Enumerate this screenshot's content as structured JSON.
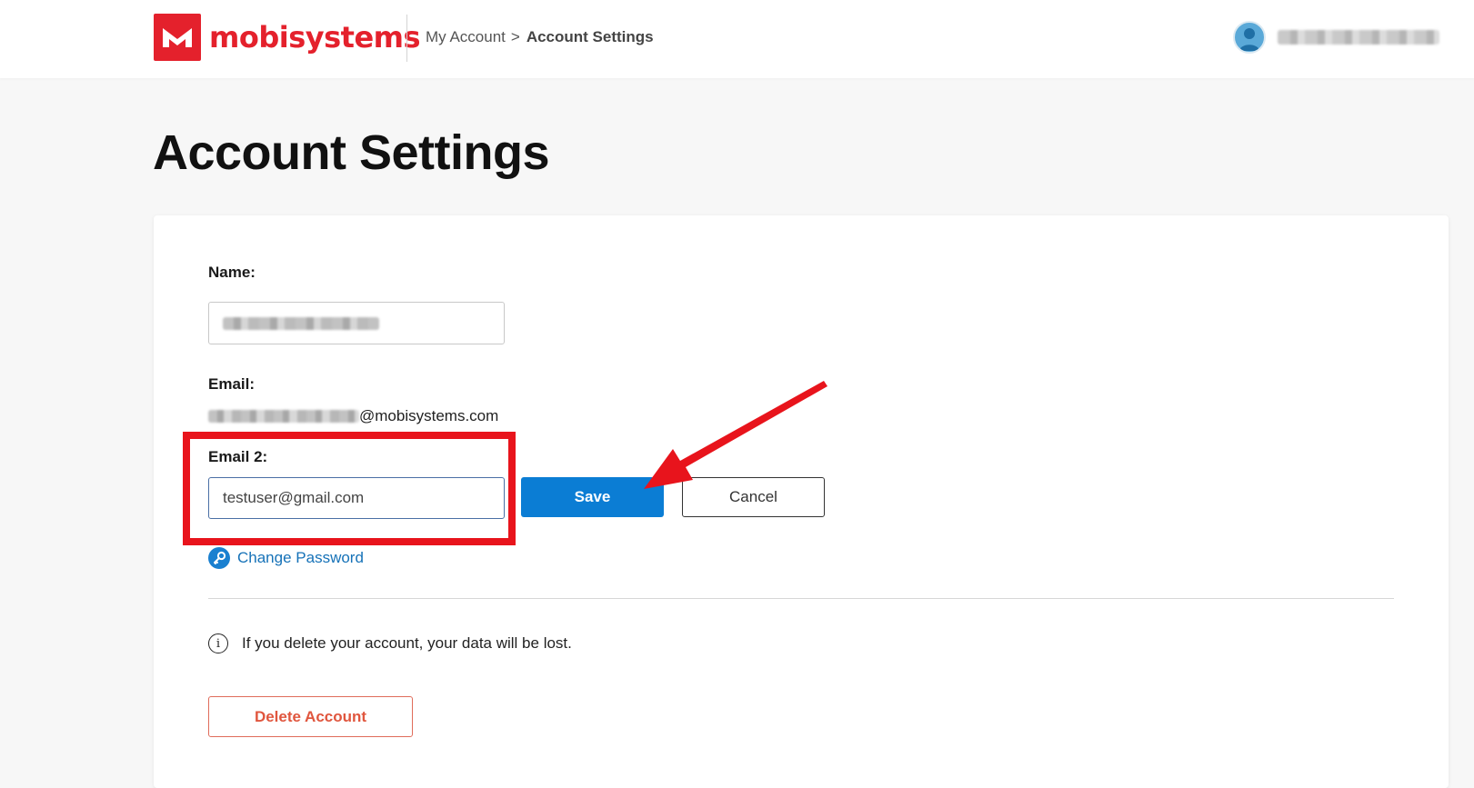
{
  "header": {
    "logo_text": "mobisystems",
    "breadcrumb": {
      "parent": "My Account",
      "separator": ">",
      "current": "Account Settings"
    }
  },
  "page": {
    "title": "Account Settings"
  },
  "form": {
    "name_label": "Name:",
    "email_label": "Email:",
    "email_domain": "@mobisystems.com",
    "email2_label": "Email 2:",
    "email2_value": "testuser@gmail.com",
    "save_label": "Save",
    "cancel_label": "Cancel",
    "change_password_label": "Change Password"
  },
  "danger_zone": {
    "info_text": "If you delete your account, your data will be lost.",
    "delete_label": "Delete Account"
  },
  "colors": {
    "brand_red": "#e4212c",
    "primary_blue": "#0b7dd4",
    "link_blue": "#1672b8",
    "delete_red": "#e0563e",
    "annotation_red": "#e8141c"
  }
}
